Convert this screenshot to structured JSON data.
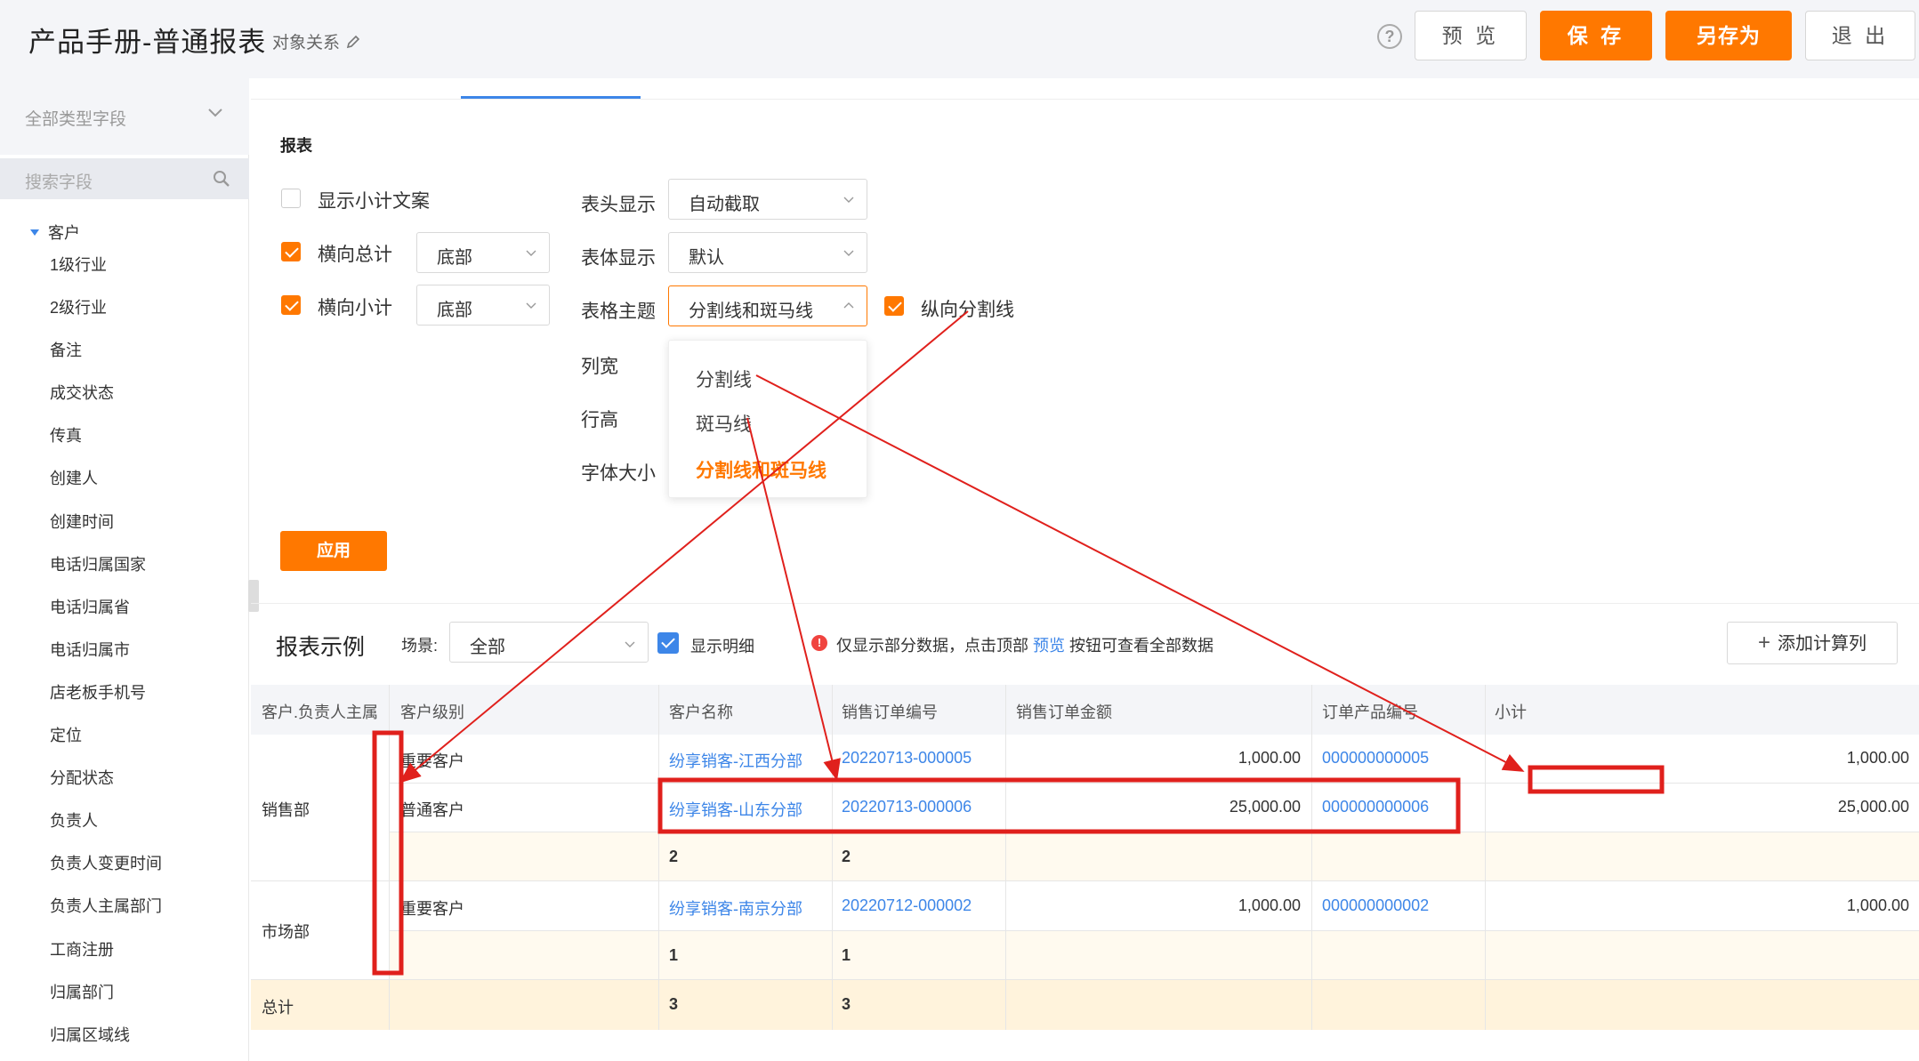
{
  "header": {
    "title": "产品手册-普通报表",
    "object_relation": "对象关系",
    "buttons": {
      "preview": "预 览",
      "save": "保 存",
      "save_as": "另存为",
      "exit": "退 出"
    }
  },
  "sidebar": {
    "type_filter": "全部类型字段",
    "search_placeholder": "搜索字段",
    "group": "客户",
    "fields": [
      "1级行业",
      "2级行业",
      "备注",
      "成交状态",
      "传真",
      "创建人",
      "创建时间",
      "电话归属国家",
      "电话归属省",
      "电话归属市",
      "店老板手机号",
      "定位",
      "分配状态",
      "负责人",
      "负责人变更时间",
      "负责人主属部门",
      "工商注册",
      "归属部门",
      "归属区域线"
    ]
  },
  "settings": {
    "section_title": "报表",
    "show_subtotal_text": "显示小计文案",
    "horizontal_total": "横向总计",
    "horizontal_total_pos": "底部",
    "horizontal_subtotal": "横向小计",
    "horizontal_subtotal_pos": "底部",
    "header_display_label": "表头显示",
    "header_display_value": "自动截取",
    "body_display_label": "表体显示",
    "body_display_value": "默认",
    "theme_label": "表格主题",
    "theme_value": "分割线和斑马线",
    "vertical_divider": "纵向分割线",
    "col_width_label": "列宽",
    "row_height_label": "行高",
    "font_size_label": "字体大小",
    "theme_options": [
      "分割线",
      "斑马线",
      "分割线和斑马线"
    ],
    "apply": "应用"
  },
  "example": {
    "title": "报表示例",
    "scene_label": "场景:",
    "scene_value": "全部",
    "show_detail": "显示明细",
    "notice_pre": "仅显示部分数据，点击顶部",
    "notice_link": "预览",
    "notice_post": "按钮可查看全部数据",
    "add_calc": "添加计算列"
  },
  "table": {
    "columns": [
      "客户.负责人主属",
      "客户级别",
      "客户名称",
      "销售订单编号",
      "销售订单金额",
      "订单产品编号",
      "小计"
    ],
    "rows": [
      {
        "dept": "",
        "level": "重要客户",
        "name": "纷享销客-江西分部",
        "order": "20220713-000005",
        "amount": "1,000.00",
        "product": "000000000005",
        "subtotal": "1,000.00"
      },
      {
        "dept": "销售部",
        "level": "普通客户",
        "name": "纷享销客-山东分部",
        "order": "20220713-000006",
        "amount": "25,000.00",
        "product": "000000000006",
        "subtotal": "25,000.00"
      },
      {
        "dept": "",
        "level": "",
        "name": "2",
        "order": "2",
        "amount": "",
        "product": "",
        "subtotal": ""
      },
      {
        "dept": "市场部",
        "level": "重要客户",
        "name": "纷享销客-南京分部",
        "order": "20220712-000002",
        "amount": "1,000.00",
        "product": "000000000002",
        "subtotal": "1,000.00"
      },
      {
        "dept": "",
        "level": "",
        "name": "1",
        "order": "1",
        "amount": "",
        "product": "",
        "subtotal": ""
      },
      {
        "dept": "总计",
        "level": "",
        "name": "3",
        "order": "3",
        "amount": "",
        "product": "",
        "subtotal": ""
      }
    ]
  },
  "colors": {
    "accent": "#ff7800",
    "link": "#3d86e8",
    "annotation": "#e0201c",
    "zebra": "#fffaef",
    "total_row": "#fff3dc"
  }
}
